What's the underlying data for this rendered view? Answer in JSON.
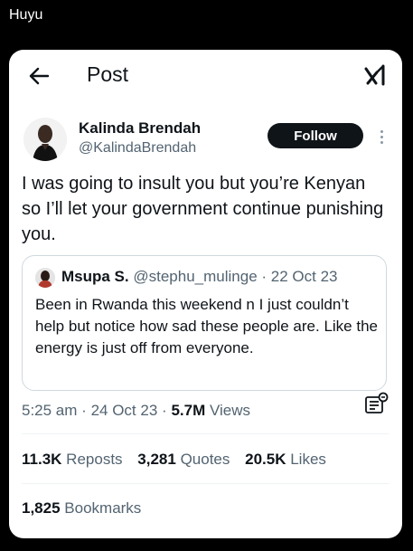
{
  "caption": "Huyu",
  "header": {
    "title": "Post",
    "back_icon": "arrow-left-icon",
    "grok_icon": "grok-icon"
  },
  "author": {
    "name": "Kalinda Brendah",
    "handle": "@KalindaBrendah",
    "follow_label": "Follow"
  },
  "tweet": {
    "text": "I was going to insult you but you’re Kenyan so I’ll let your government continue punishing you."
  },
  "quote": {
    "name": "Msupa S.",
    "handle": "@stephu_mulinge",
    "separator": "·",
    "date": "22 Oct 23",
    "text": "Been in Rwanda this weekend n I just couldn’t help but notice how sad these people are. Like the energy is just off from everyone."
  },
  "meta": {
    "time": "5:25 am",
    "separator": "·",
    "date": "24 Oct 23",
    "views_count": "5.7M",
    "views_label": "Views"
  },
  "stats": {
    "reposts_count": "11.3K",
    "reposts_label": "Reposts",
    "quotes_count": "3,281",
    "quotes_label": "Quotes",
    "likes_count": "20.5K",
    "likes_label": "Likes",
    "bookmarks_count": "1,825",
    "bookmarks_label": "Bookmarks"
  },
  "colors": {
    "background": "#000000",
    "card": "#ffffff",
    "text_primary": "#0f1419",
    "text_secondary": "#536471",
    "border": "#cfd9de",
    "follow_bg": "#0f1419"
  }
}
